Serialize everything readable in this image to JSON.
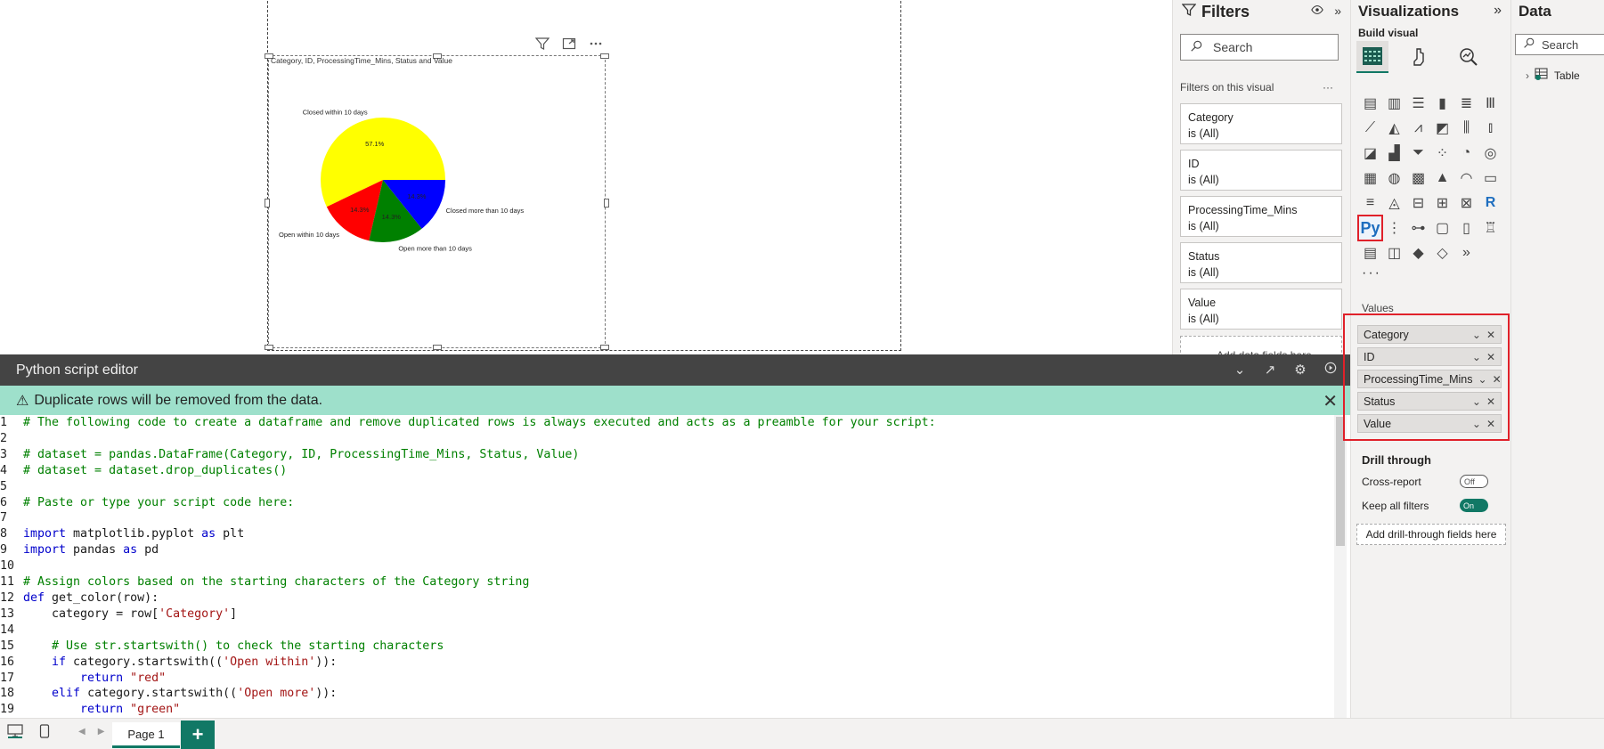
{
  "visual": {
    "title": "Category, ID, ProcessingTime_Mins, Status and Value"
  },
  "chart_data": {
    "type": "pie",
    "categories": [
      "Closed within 10 days",
      "Open within 10 days",
      "Open more than 10 days",
      "Closed more than 10 days"
    ],
    "values": [
      57.1,
      14.3,
      14.3,
      14.3
    ],
    "pct_labels": [
      "57.1%",
      "14.3%",
      "14.3%",
      "14.3%"
    ],
    "colors": [
      "#ffff00",
      "#ff0000",
      "#008000",
      "#0000ff"
    ],
    "title": ""
  },
  "editor": {
    "title": "Python script editor",
    "warning": "Duplicate rows will be removed from the data.",
    "lines": [
      {
        "n": "1",
        "t": "# The following code to create a dataframe and remove duplicated rows is always executed and acts as a preamble for your script:",
        "c": "cmt"
      },
      {
        "n": "2",
        "t": "",
        "c": "ct"
      },
      {
        "n": "3",
        "t": "# dataset = pandas.DataFrame(Category, ID, ProcessingTime_Mins, Status, Value)",
        "c": "cmt"
      },
      {
        "n": "4",
        "t": "# dataset = dataset.drop_duplicates()",
        "c": "cmt"
      },
      {
        "n": "5",
        "t": "",
        "c": "ct"
      },
      {
        "n": "6",
        "t": "# Paste or type your script code here:",
        "c": "cmt"
      },
      {
        "n": "7",
        "t": "",
        "c": "ct"
      },
      {
        "n": "8",
        "t": "import matplotlib.pyplot as plt",
        "c": "kw"
      },
      {
        "n": "9",
        "t": "import pandas as pd",
        "c": "kw"
      },
      {
        "n": "10",
        "t": "",
        "c": "ct"
      },
      {
        "n": "11",
        "t": "# Assign colors based on the starting characters of the Category string",
        "c": "cmt"
      },
      {
        "n": "12",
        "t": "def get_color(row):",
        "c": "kw"
      },
      {
        "n": "13",
        "t": "    category = row['Category']",
        "c": "ct"
      },
      {
        "n": "14",
        "t": "",
        "c": "ct"
      },
      {
        "n": "15",
        "t": "    # Use str.startswith() to check the starting characters",
        "c": "cmt"
      },
      {
        "n": "16",
        "t": "    if category.startswith(('Open within')):",
        "c": "kw"
      },
      {
        "n": "17",
        "t": "        return \"red\"",
        "c": "kw"
      },
      {
        "n": "18",
        "t": "    elif category.startswith(('Open more')):",
        "c": "kw"
      },
      {
        "n": "19",
        "t": "        return \"green\"",
        "c": "kw"
      }
    ]
  },
  "filters": {
    "title": "Filters",
    "search_placeholder": "Search",
    "subheading": "Filters on this visual",
    "cards": [
      {
        "name": "Category",
        "state": "is (All)"
      },
      {
        "name": "ID",
        "state": "is (All)"
      },
      {
        "name": "ProcessingTime_Mins",
        "state": "is (All)"
      },
      {
        "name": "Status",
        "state": "is (All)"
      },
      {
        "name": "Value",
        "state": "is (All)"
      }
    ],
    "add_fields": "Add data fields here"
  },
  "viz": {
    "title": "Visualizations",
    "build_label": "Build visual",
    "values_label": "Values",
    "fields": [
      "Category",
      "ID",
      "ProcessingTime_Mins",
      "Status",
      "Value"
    ],
    "drill_title": "Drill through",
    "cross_report": "Cross-report",
    "cross_report_state": "Off",
    "keep_filters": "Keep all filters",
    "keep_filters_state": "On",
    "drill_add": "Add drill-through fields here",
    "py_label": "Py",
    "r_label": "R"
  },
  "data": {
    "title": "Data",
    "search_placeholder": "Search",
    "table": "Table"
  },
  "pages": {
    "current": "Page 1",
    "add": "+"
  }
}
